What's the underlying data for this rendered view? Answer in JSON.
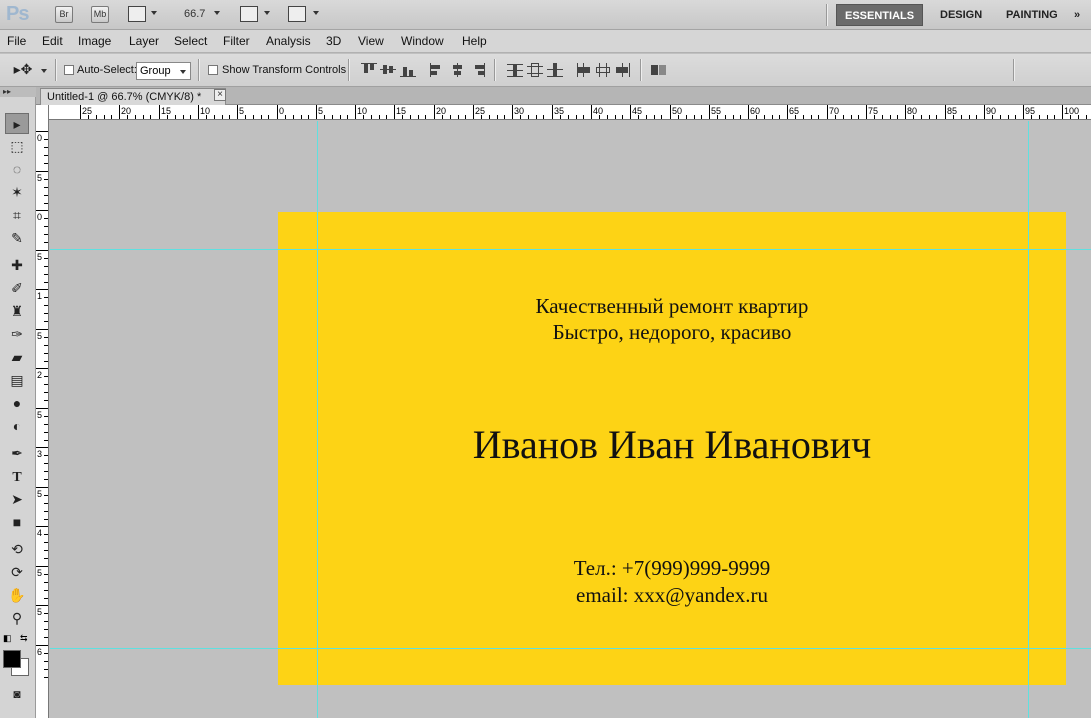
{
  "app": {
    "logo": "Ps",
    "bridge_label": "Br",
    "minibridge_label": "Mb",
    "zoom": "66.7"
  },
  "workspaces": [
    "ESSENTIALS",
    "DESIGN",
    "PAINTING"
  ],
  "menu": [
    "File",
    "Edit",
    "Image",
    "Layer",
    "Select",
    "Filter",
    "Analysis",
    "3D",
    "View",
    "Window",
    "Help"
  ],
  "options": {
    "auto_select_label": "Auto-Select:",
    "auto_select_value": "Group",
    "transform_label": "Show Transform Controls"
  },
  "document": {
    "tab_title": "Untitled-1 @ 66.7% (CMYK/8) *",
    "close_glyph": "×"
  },
  "ruler_h_labels": [
    "25",
    "20",
    "15",
    "10",
    "5",
    "0",
    "5",
    "10",
    "15",
    "20",
    "25",
    "30",
    "35",
    "40",
    "45",
    "50",
    "55",
    "60",
    "65",
    "70",
    "75",
    "80",
    "85",
    "90",
    "95",
    "100"
  ],
  "ruler_v_labels": [
    "0",
    "5",
    "0",
    "5",
    "1",
    "5",
    "2",
    "5",
    "3",
    "5",
    "4",
    "5",
    "5",
    "6"
  ],
  "card": {
    "line1": "Качественный ремонт квартир",
    "line2": "Быстро, недорого, красиво",
    "name": "Иванов Иван Иванович",
    "phone": "Тел.: +7(999)999-9999",
    "email": "email: xxx@yandex.ru",
    "color": "#fdd315"
  },
  "tools": [
    "move-icon",
    "marquee-icon",
    "lasso-icon",
    "quick-select-icon",
    "crop-icon",
    "eyedropper-icon",
    "healing-brush-icon",
    "brush-icon",
    "clone-stamp-icon",
    "history-brush-icon",
    "eraser-icon",
    "gradient-icon",
    "blur-icon",
    "dodge-icon",
    "pen-icon",
    "type-icon",
    "path-select-icon",
    "shape-icon",
    "3d-rotate-icon",
    "3d-orbit-icon",
    "hand-icon",
    "zoom-icon"
  ]
}
